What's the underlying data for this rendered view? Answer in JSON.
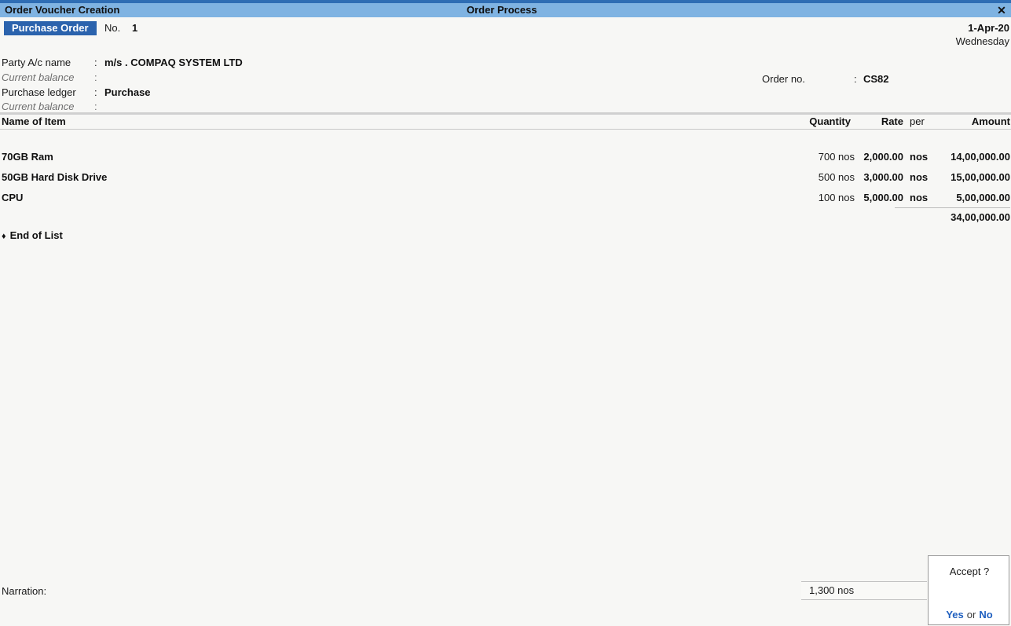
{
  "window": {
    "title": "Order Voucher Creation",
    "center_title": "Order Process",
    "close_icon": "close-icon",
    "close_glyph": "✕"
  },
  "voucher": {
    "type_badge": "Purchase Order",
    "number_label": "No.",
    "number_value": "1",
    "date": "1-Apr-20",
    "weekday": "Wednesday"
  },
  "fields": {
    "party_label": "Party A/c name",
    "party_colon": ":",
    "party_value": "m/s . COMPAQ SYSTEM LTD",
    "party_balance_label": "Current balance",
    "party_balance_colon": ":",
    "party_balance_value": "",
    "ledger_label": "Purchase ledger",
    "ledger_colon": ":",
    "ledger_value": "Purchase",
    "ledger_balance_label": "Current balance",
    "ledger_balance_colon": ":",
    "ledger_balance_value": "",
    "order_no_label": "Order no.",
    "order_no_colon": ":",
    "order_no_value": "CS82"
  },
  "table": {
    "headers": {
      "item": "Name of Item",
      "quantity": "Quantity",
      "rate": "Rate",
      "per": "per",
      "amount": "Amount"
    },
    "rows": [
      {
        "item": "70GB Ram",
        "quantity": "700 nos",
        "rate": "2,000.00",
        "per": "nos",
        "amount": "14,00,000.00"
      },
      {
        "item": "50GB Hard Disk Drive",
        "quantity": "500 nos",
        "rate": "3,000.00",
        "per": "nos",
        "amount": "15,00,000.00"
      },
      {
        "item": "CPU",
        "quantity": "100 nos",
        "rate": "5,000.00",
        "per": "nos",
        "amount": "5,00,000.00"
      }
    ],
    "total_amount": "34,00,000.00",
    "end_of_list": "End of List",
    "end_of_list_marker": "♦"
  },
  "footer": {
    "narration_label": "Narration:",
    "quantity_total": "1,300 nos"
  },
  "accept_dialog": {
    "title": "Accept ?",
    "yes": "Yes",
    "or": "or",
    "no": "No"
  },
  "colors": {
    "title_bar": "#7fb3e2",
    "top_strip": "#2e6db4",
    "badge": "#2b63ad",
    "background": "#f7f7f5",
    "link": "#1f5fbf"
  }
}
